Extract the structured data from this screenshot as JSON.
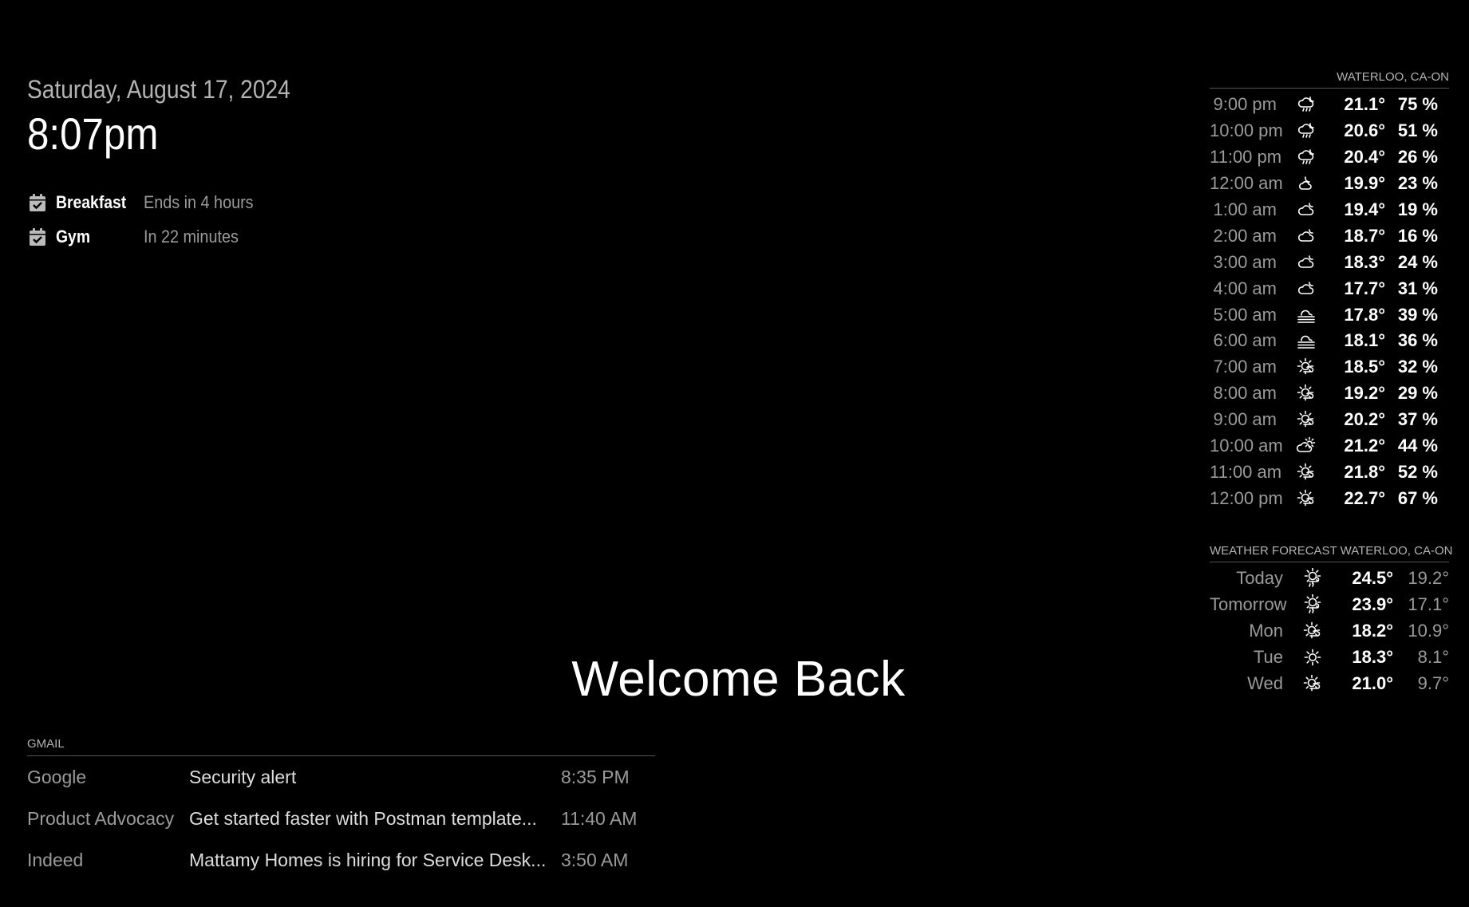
{
  "clock": {
    "date": "Saturday, August 17, 2024",
    "time": "8:07pm"
  },
  "calendar": {
    "events": [
      {
        "title": "Breakfast",
        "time": "Ends in 4 hours",
        "icon": "calendar-check-icon"
      },
      {
        "title": "Gym",
        "time": "In 22 minutes",
        "icon": "calendar-check-icon"
      }
    ]
  },
  "welcome": "Welcome Back",
  "gmail": {
    "header": "GMAIL",
    "messages": [
      {
        "from": "Google",
        "subject": "Security alert",
        "time": "8:35 PM"
      },
      {
        "from": "Product Advocacy",
        "subject": "Get started faster with Postman template...",
        "time": "11:40 AM"
      },
      {
        "from": "Indeed",
        "subject": "Mattamy Homes is hiring for Service Desk...",
        "time": "3:50 AM"
      }
    ]
  },
  "weather": {
    "header": "WATERLOO, CA-ON",
    "hourly": [
      {
        "time": "9:00 pm",
        "icon": "night-cloudy-rain-icon",
        "temp": "21.1°",
        "humidity": "75 %"
      },
      {
        "time": "10:00 pm",
        "icon": "night-cloudy-rain-icon",
        "temp": "20.6°",
        "humidity": "51 %"
      },
      {
        "time": "11:00 pm",
        "icon": "night-cloudy-rain-icon",
        "temp": "20.4°",
        "humidity": "26 %"
      },
      {
        "time": "12:00 am",
        "icon": "night-partly-cloudy-icon",
        "temp": "19.9°",
        "humidity": "23 %"
      },
      {
        "time": "1:00 am",
        "icon": "night-cloudy-icon",
        "temp": "19.4°",
        "humidity": "19 %"
      },
      {
        "time": "2:00 am",
        "icon": "night-cloudy-icon",
        "temp": "18.7°",
        "humidity": "16 %"
      },
      {
        "time": "3:00 am",
        "icon": "night-cloudy-icon",
        "temp": "18.3°",
        "humidity": "24 %"
      },
      {
        "time": "4:00 am",
        "icon": "night-cloudy-icon",
        "temp": "17.7°",
        "humidity": "31 %"
      },
      {
        "time": "5:00 am",
        "icon": "fog-icon",
        "temp": "17.8°",
        "humidity": "39 %"
      },
      {
        "time": "6:00 am",
        "icon": "fog-icon",
        "temp": "18.1°",
        "humidity": "36 %"
      },
      {
        "time": "7:00 am",
        "icon": "day-sunny-overcast-icon",
        "temp": "18.5°",
        "humidity": "32 %"
      },
      {
        "time": "8:00 am",
        "icon": "day-sunny-overcast-icon",
        "temp": "19.2°",
        "humidity": "29 %"
      },
      {
        "time": "9:00 am",
        "icon": "day-sunny-overcast-icon",
        "temp": "20.2°",
        "humidity": "37 %"
      },
      {
        "time": "10:00 am",
        "icon": "day-cloudy-icon",
        "temp": "21.2°",
        "humidity": "44 %"
      },
      {
        "time": "11:00 am",
        "icon": "day-sunny-overcast-icon",
        "temp": "21.8°",
        "humidity": "52 %"
      },
      {
        "time": "12:00 pm",
        "icon": "day-sunny-overcast-icon",
        "temp": "22.7°",
        "humidity": "67 %"
      }
    ]
  },
  "forecast": {
    "header": "WEATHER FORECAST WATERLOO, CA-ON",
    "days": [
      {
        "day": "Today",
        "icon": "day-rain-icon",
        "max": "24.5°",
        "min": "19.2°"
      },
      {
        "day": "Tomorrow",
        "icon": "day-rain-icon",
        "max": "23.9°",
        "min": "17.1°"
      },
      {
        "day": "Mon",
        "icon": "day-sunny-overcast-icon",
        "max": "18.2°",
        "min": "10.9°"
      },
      {
        "day": "Tue",
        "icon": "day-sunny-icon",
        "max": "18.3°",
        "min": "8.1°"
      },
      {
        "day": "Wed",
        "icon": "day-sunny-overcast-icon",
        "max": "21.0°",
        "min": "9.7°"
      }
    ]
  }
}
